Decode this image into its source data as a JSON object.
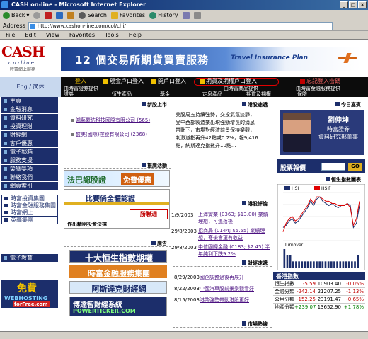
{
  "browser": {
    "title": "CASH on-line - Microsoft Internet Explorer",
    "toolbar": {
      "back": "Back",
      "search": "Search",
      "favorites": "Favorites",
      "history": "History"
    },
    "address_label": "Address",
    "address": "http://www.cashon-line.com/col/chi/",
    "menu": [
      "File",
      "Edit",
      "View",
      "Favorites",
      "Tools",
      "Help"
    ]
  },
  "header": {
    "logo_main": "CASH",
    "logo_sub": "on-line",
    "logo_small": "時富網上服務",
    "banner_title": "12 個交易所期貨買賣服務",
    "banner_subtitle": "Travel Insurance Plan",
    "lang": "Eng / 简体"
  },
  "login": {
    "login": "登入",
    "cash_login": "現金戶口登入",
    "open_account": "開戶口登入",
    "futures_login": "期貨及期權戶口登入",
    "forgot": "忘記登入密碼",
    "sub1": "由時富證券提供",
    "sub2": "由時富商品提供",
    "sub3": "由時富金融服務提供"
  },
  "topmenu": {
    "items": [
      "證券",
      "衍生產品",
      "基金",
      "定息產品",
      "期貨及期權",
      "保險"
    ]
  },
  "sidebar": {
    "main": [
      "主頁",
      "金融消息",
      "資料研究",
      "投資理財",
      "財經網",
      "客戶優惠",
      "電子郵箱",
      "服務支援",
      "榮獲獎項",
      "聯絡我們",
      "網頁索引"
    ],
    "secondary": [
      "時富投資集團",
      "時富金融服務集團",
      "時富網上",
      "英高集團"
    ],
    "partner": "電子教育",
    "ad_t1": "免費",
    "ad_t2": "WEBHOSTING",
    "ad_t3": "forFree.com"
  },
  "sections": {
    "new_listing": "新股上市",
    "promo": "推廣活動",
    "ads": "廣告",
    "market_watch": "港股速遞",
    "market_comment": "港股評論",
    "finance_news": "財經速遞",
    "market_hotspot": "市場熱線",
    "today_guest": "今日嘉賓",
    "index_chart": "恒生指數圖表",
    "stock_quote": "股票報價"
  },
  "new_listings": [
    "鴻藝縈紡科技國際有限公司 (565)",
    "盛美(國際)控股有限公司 (2368)"
  ],
  "market_watch_text": {
    "line1": "美股周五持續強勢，交投氣氛淡靜，",
    "line2": "受中西部製造業出現強勁增長的消息",
    "line3": "帶動下，市場對經濟前景保持樂觀，",
    "line4": "刺激道指再升42點或0.2%，報9,416",
    "line5": "點，納斯達克指數升10點..."
  },
  "comments": [
    {
      "date": "1/9/2003",
      "title": "上海實業 (0363; $13.00) 業績",
      "title2": "理想，可追落後"
    },
    {
      "date": "29/8/2003",
      "title": "招商局 (0144; $5.55) 業績理",
      "title2": "想，寒後會更有收益"
    },
    {
      "date": "29/8/2003",
      "title": "中信國際金融 (0183; $2.45) 半",
      "title2": "年純利下跌9.2%"
    }
  ],
  "finance_news_items": [
    {
      "date": "8/29/2003",
      "title": "國企調整過後再展升"
    },
    {
      "date": "8/22/2003",
      "title": "中國汽車股前景樂觀看好"
    },
    {
      "date": "8/15/2003",
      "title": "港幣強勢帶動港股更好"
    }
  ],
  "guest": {
    "name": "劉仲坤",
    "title1": "時富證券",
    "title2": "資料研究部董事"
  },
  "quote": {
    "label": "股票報價",
    "button": "GO"
  },
  "ads": {
    "ad1": "法巴認股證",
    "ad1b": "免費優惠",
    "ad2": "比賽倘全體認證",
    "ad2b": "作出精明投資決擇",
    "ad3": "十大恒生指數期權",
    "ad4": "時富金融服務集團",
    "ad5": "阿斯達克財經網",
    "ad6": "博達智財經系統",
    "ad6b": "POWERTICKER.COM"
  },
  "chart_legend": {
    "hsi": "HSI",
    "hsif": "HSIF",
    "turnover": "Turnover"
  },
  "chart_data": [
    {
      "type": "line",
      "title": "",
      "series": [
        {
          "name": "HSI",
          "values": [
            10760,
            10770,
            10790,
            10800,
            10780,
            10790,
            10810,
            10830,
            10850,
            10880,
            10860,
            10890,
            10900,
            10880,
            10870,
            10860,
            10870,
            10860,
            10850,
            10860,
            10860,
            10870,
            10860,
            10760,
            10780,
            10860
          ]
        },
        {
          "name": "HSIF",
          "values": [
            10740,
            10780,
            10800,
            10810,
            10790,
            10800,
            10820,
            10840,
            10860,
            10890,
            10870,
            10900,
            10900,
            10890,
            10880,
            10880,
            10870,
            10870,
            10860,
            10860,
            10860,
            10870,
            10850,
            10770,
            10800,
            10880
          ]
        }
      ],
      "ylim": [
        10700,
        10920
      ]
    },
    {
      "type": "bar",
      "title": "",
      "series": [
        {
          "name": "Turnover",
          "values": [
            3,
            2,
            2,
            1,
            1,
            1,
            1,
            1,
            1,
            1,
            1,
            1,
            1,
            1,
            1,
            1,
            1,
            1,
            1,
            1,
            1,
            1,
            1,
            1,
            1,
            2
          ]
        }
      ]
    }
  ],
  "indices": {
    "heading": "香港指數",
    "rows": [
      {
        "name": "恒生指數",
        "change": "-5.59",
        "value": "10903.40",
        "pct": "-0.05%"
      },
      {
        "name": "金融分類",
        "change": "-242.14",
        "value": "21207.25",
        "pct": "-1.13%"
      },
      {
        "name": "公用分類",
        "change": "-152.25",
        "value": "23191.47",
        "pct": "-0.65%"
      },
      {
        "name": "地產分類",
        "change": "+239.07",
        "value": "13652.90",
        "pct": "+1.78%"
      }
    ]
  }
}
